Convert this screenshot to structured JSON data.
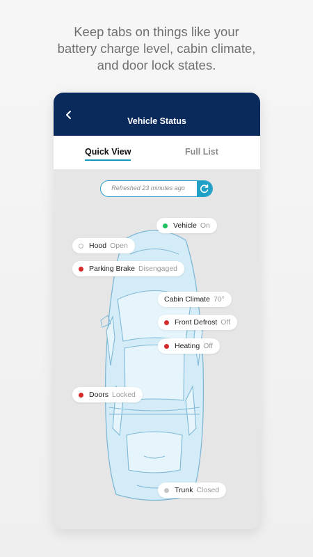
{
  "caption": {
    "line1": "Keep tabs on things like your",
    "line2": "battery charge level, cabin climate,",
    "line3": "and door lock states."
  },
  "header": {
    "title": "Vehicle Status",
    "back_icon": "chevron-left-icon"
  },
  "tabs": [
    {
      "label": "Quick View",
      "active": true
    },
    {
      "label": "Full List",
      "active": false
    }
  ],
  "refresh": {
    "text": "Refreshed 23 minutes ago",
    "icon": "refresh-icon"
  },
  "colors": {
    "header": "#0b2a5c",
    "accent": "#1e9fc6",
    "alert": "#d42a2a",
    "ok": "#22c060"
  },
  "status": {
    "vehicle": {
      "label": "Vehicle",
      "value": "On",
      "indicator": "green"
    },
    "hood": {
      "label": "Hood",
      "value": "Open",
      "indicator": "hollow"
    },
    "parking_brake": {
      "label": "Parking Brake",
      "value": "Disengaged",
      "indicator": "red"
    },
    "cabin_climate": {
      "label": "Cabin Climate",
      "value": "70°"
    },
    "front_defrost": {
      "label": "Front Defrost",
      "value": "Off",
      "indicator": "red"
    },
    "heating": {
      "label": "Heating",
      "value": "Off",
      "indicator": "red"
    },
    "doors": {
      "label": "Doors",
      "value": "Locked",
      "indicator": "red"
    },
    "trunk": {
      "label": "Trunk",
      "value": "Closed",
      "indicator": "gray"
    }
  }
}
